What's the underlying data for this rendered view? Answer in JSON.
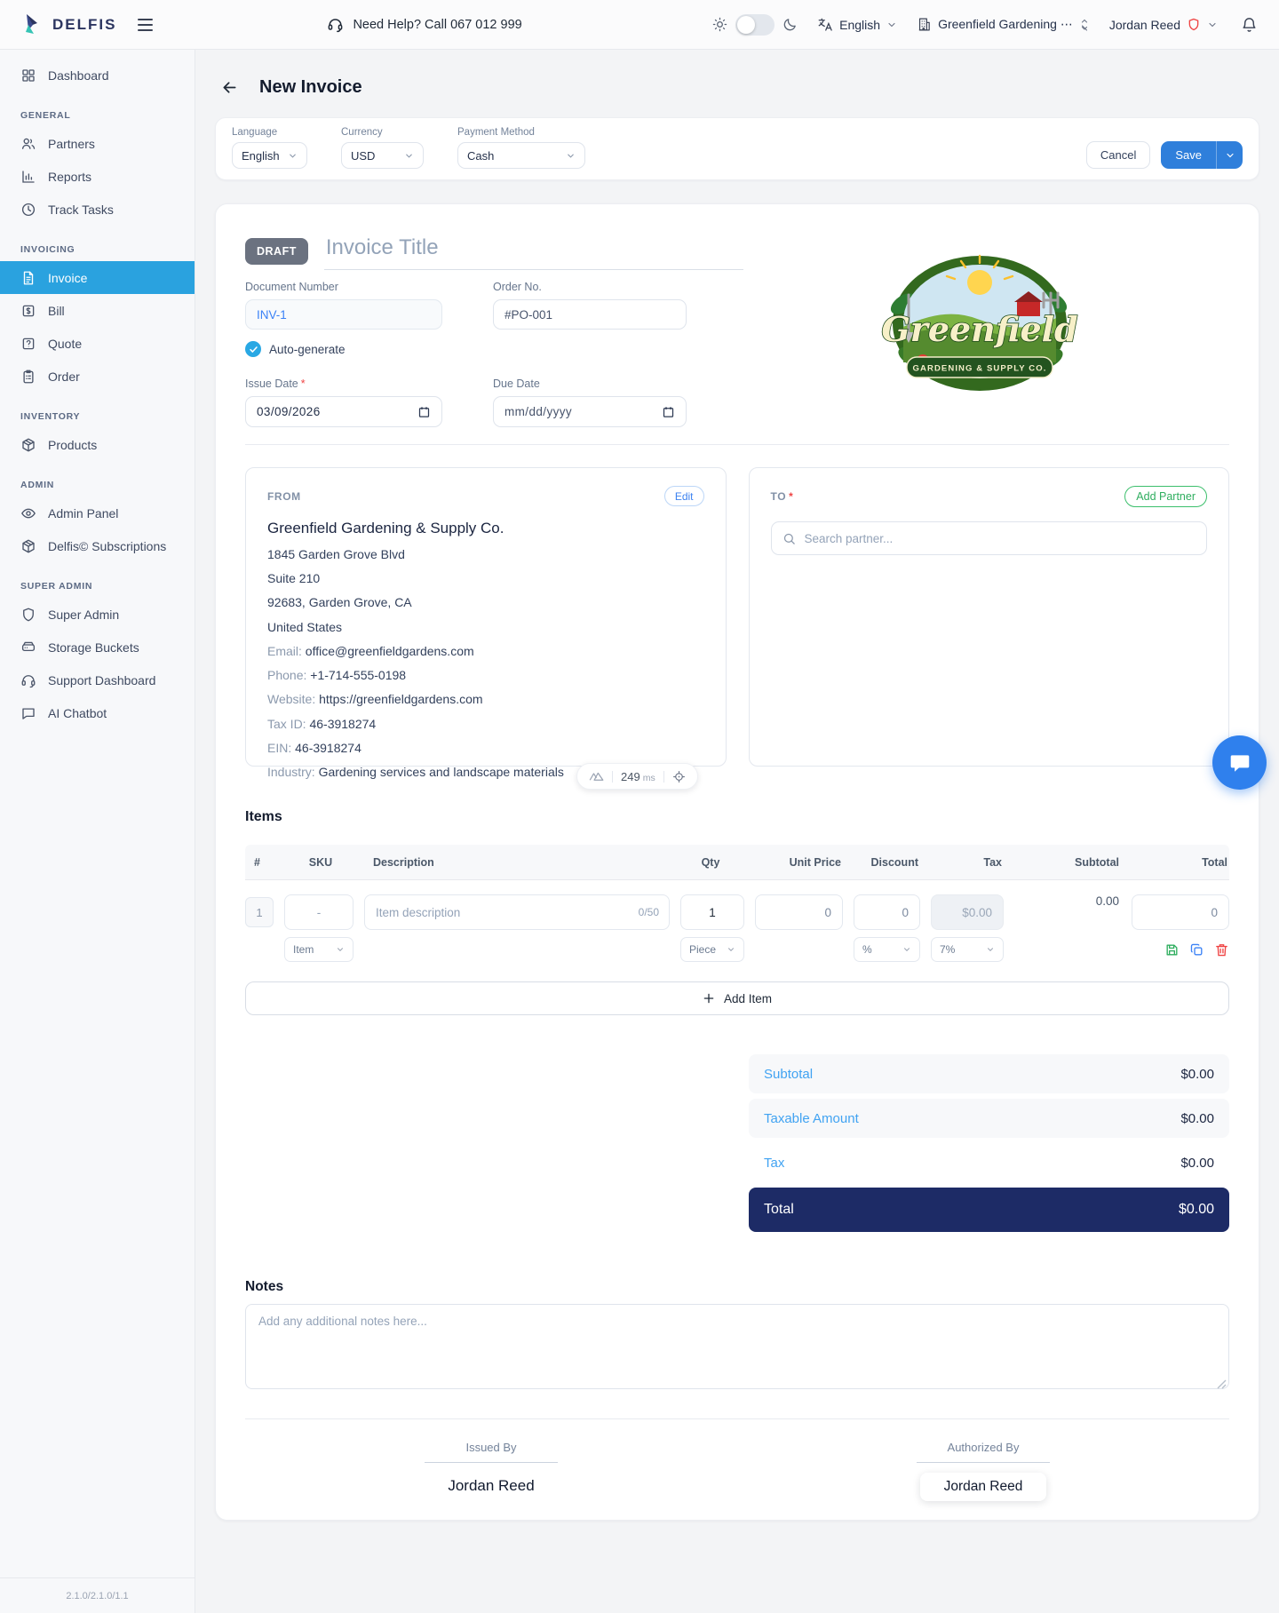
{
  "colors": {
    "active_sidebar_blue": "#2aa2df",
    "save_button_blue": "#2f7fdb",
    "link_blue": "#3b82f6",
    "totals_label_blue": "#41a3f2",
    "total_bar_navy": "#1d2b66",
    "add_partner_green": "#2fae5f",
    "danger_red": "#ef4444",
    "draft_badge_gray": "#6b7280"
  },
  "topbar": {
    "brand": "DELFIS",
    "help_text": "Need Help? Call 067 012 999",
    "language": "English",
    "company": "Greenfield Gardening ⋯",
    "user": "Jordan Reed"
  },
  "sidebar": {
    "sections": [
      {
        "header": "",
        "items": [
          {
            "label": "Dashboard"
          }
        ]
      },
      {
        "header": "GENERAL",
        "items": [
          {
            "label": "Partners"
          },
          {
            "label": "Reports"
          },
          {
            "label": "Track Tasks"
          }
        ]
      },
      {
        "header": "INVOICING",
        "items": [
          {
            "label": "Invoice"
          },
          {
            "label": "Bill"
          },
          {
            "label": "Quote"
          },
          {
            "label": "Order"
          }
        ]
      },
      {
        "header": "INVENTORY",
        "items": [
          {
            "label": "Products"
          }
        ]
      },
      {
        "header": "ADMIN",
        "items": [
          {
            "label": "Admin Panel"
          },
          {
            "label": "Delfis© Subscriptions"
          }
        ]
      },
      {
        "header": "SUPER ADMIN",
        "items": [
          {
            "label": "Super Admin"
          },
          {
            "label": "Storage Buckets"
          },
          {
            "label": "Support Dashboard"
          },
          {
            "label": "AI Chatbot"
          }
        ]
      }
    ],
    "version": "2.1.0/2.1.0/1.1"
  },
  "header": {
    "title": "New Invoice"
  },
  "settings": {
    "language_label": "Language",
    "language_value": "English",
    "currency_label": "Currency",
    "currency_value": "USD",
    "payment_label": "Payment Method",
    "payment_value": "Cash",
    "cancel_label": "Cancel",
    "save_label": "Save"
  },
  "invoice": {
    "status": "DRAFT",
    "title_placeholder": "Invoice Title",
    "document_number_label": "Document Number",
    "document_number": "INV-1",
    "auto_generate_label": "Auto-generate",
    "order_no_label": "Order No.",
    "order_no_placeholder": "#PO-001",
    "issue_date_label": "Issue Date",
    "issue_date": "03/09/2026",
    "due_date_label": "Due Date",
    "due_date_placeholder": "mm/dd/yyyy",
    "required_mark": "*"
  },
  "logo": {
    "name": "Greenfield",
    "banner": "GARDENING & SUPPLY CO."
  },
  "from": {
    "label": "FROM",
    "edit_label": "Edit",
    "company": "Greenfield Gardening & Supply Co.",
    "address_lines": [
      "1845 Garden Grove Blvd",
      "Suite 210",
      "92683, Garden Grove, CA",
      "United States"
    ],
    "fields": [
      {
        "label": "Email:",
        "value": "office@greenfieldgardens.com"
      },
      {
        "label": "Phone:",
        "value": "+1-714-555-0198"
      },
      {
        "label": "Website:",
        "value": "https://greenfieldgardens.com"
      },
      {
        "label": "Tax ID:",
        "value": "46-3918274"
      },
      {
        "label": "EIN:",
        "value": "46-3918274"
      },
      {
        "label": "Industry:",
        "value": "Gardening services and landscape materials"
      }
    ],
    "latency_value": "249",
    "latency_unit": "ms"
  },
  "to": {
    "label": "TO",
    "add_partner_label": "Add Partner",
    "search_placeholder": "Search partner..."
  },
  "items": {
    "heading": "Items",
    "columns": [
      "#",
      "SKU",
      "Description",
      "Qty",
      "Unit Price",
      "Discount",
      "Tax",
      "Subtotal",
      "Total"
    ],
    "row": {
      "index": "1",
      "sku_placeholder": "-",
      "type_value": "Item",
      "description_placeholder": "Item description",
      "char_counter": "0/50",
      "qty": "1",
      "unit_value": "Piece",
      "unit_price": "0",
      "discount": "0",
      "discount_unit": "%",
      "tax": "$0.00",
      "tax_rate": "7%",
      "subtotal": "0.00",
      "total": "0"
    },
    "add_item_label": "Add Item"
  },
  "totals": {
    "rows": [
      {
        "label": "Subtotal",
        "value": "$0.00"
      },
      {
        "label": "Taxable Amount",
        "value": "$0.00"
      },
      {
        "label": "Tax",
        "value": "$0.00"
      }
    ],
    "total_label": "Total",
    "total_value": "$0.00"
  },
  "notes": {
    "heading": "Notes",
    "placeholder": "Add any additional notes here..."
  },
  "signatures": {
    "issued_by_label": "Issued By",
    "issued_by_name": "Jordan Reed",
    "authorized_by_label": "Authorized By",
    "authorized_by_name": "Jordan Reed"
  }
}
